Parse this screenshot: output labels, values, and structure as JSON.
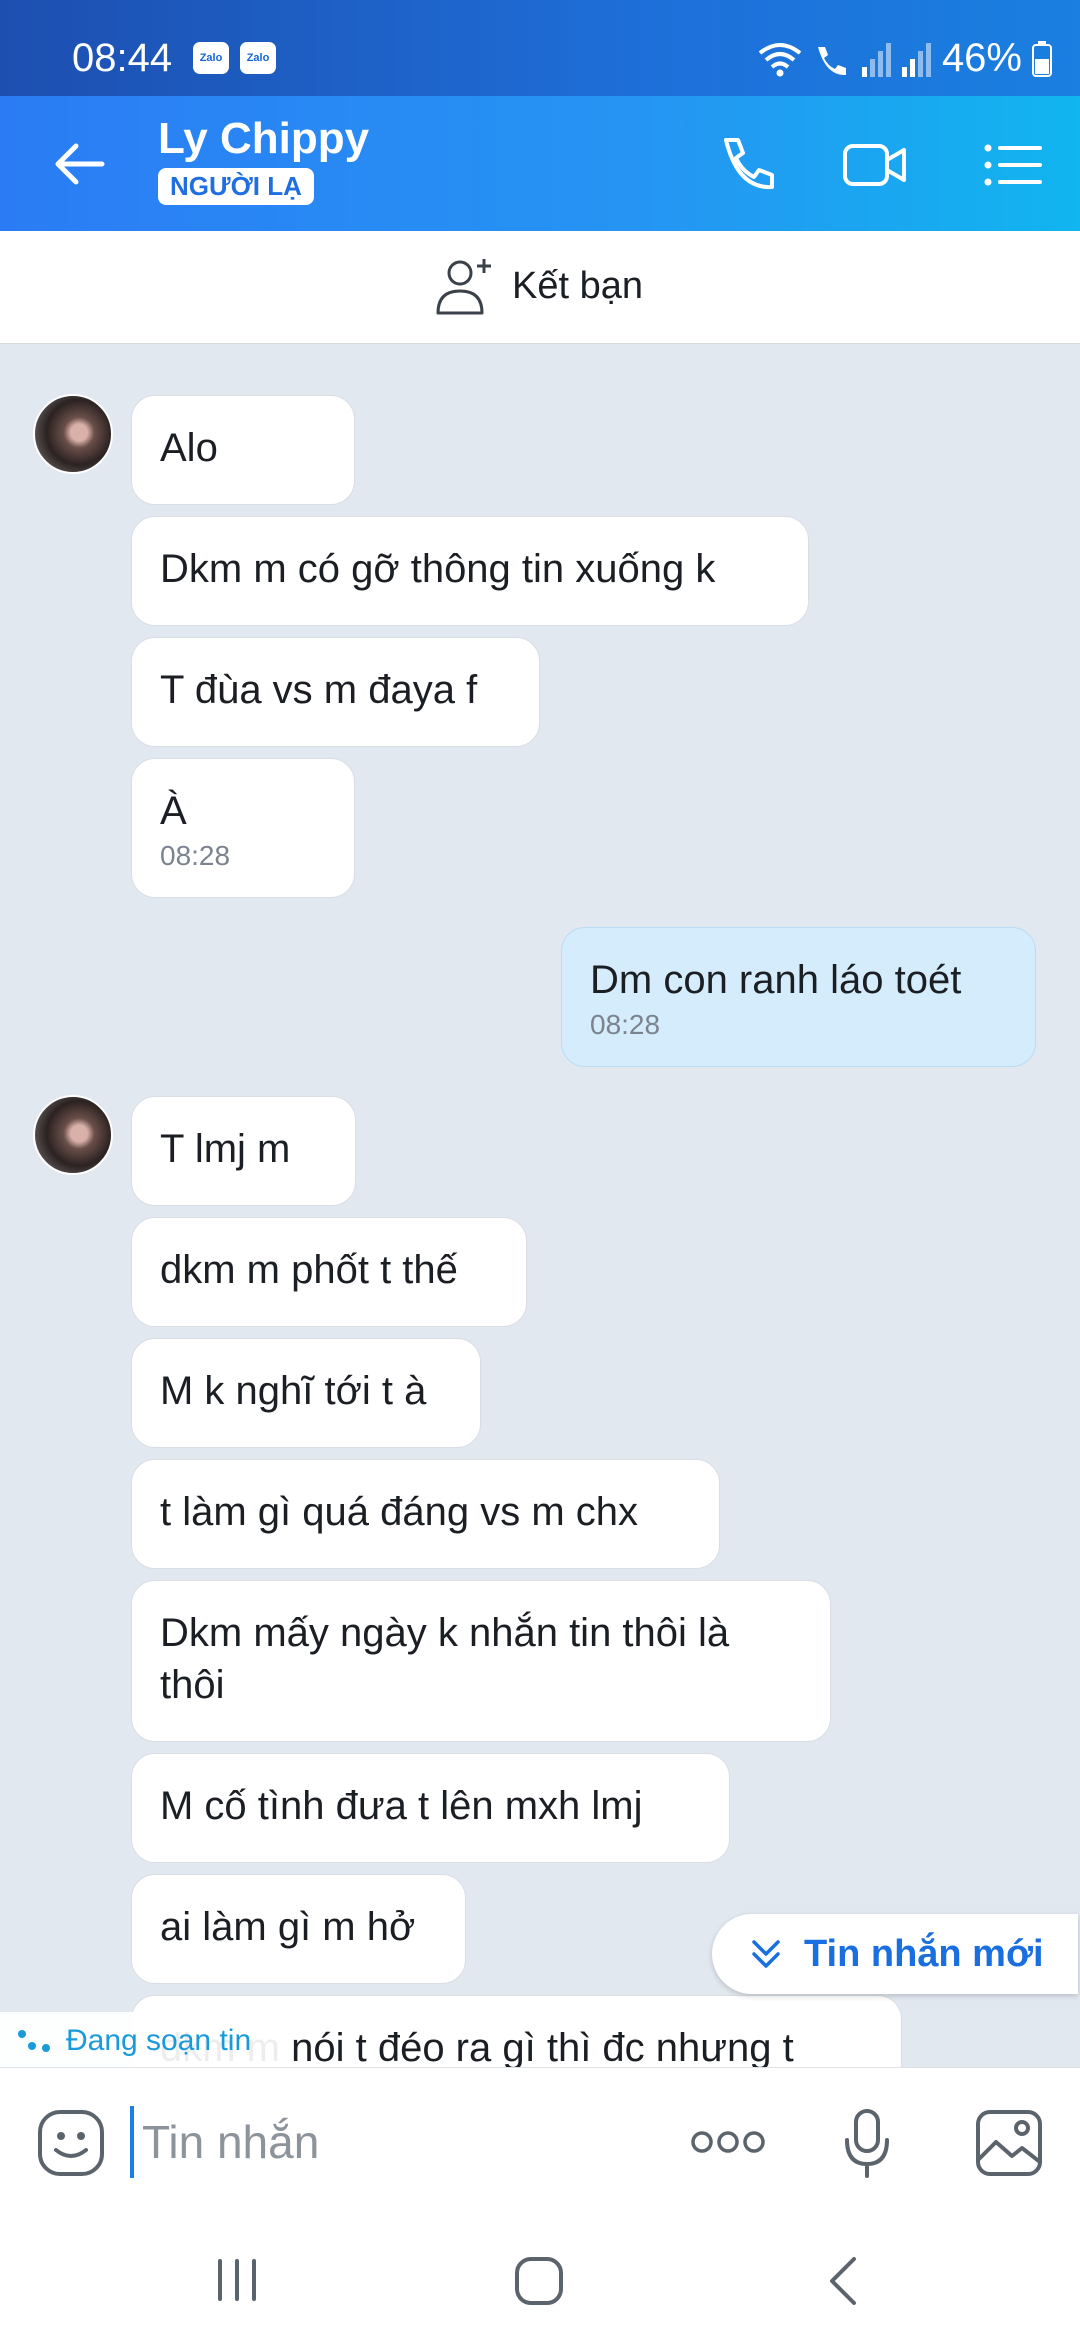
{
  "status_bar": {
    "time": "08:44",
    "badge_1": "Zalo",
    "badge_2": "Zalo",
    "battery": "46%"
  },
  "header": {
    "contact_name": "Ly Chippy",
    "badge": "NGƯỜI LẠ"
  },
  "add_friend": {
    "label": "Kết bạn"
  },
  "messages": [
    {
      "text": "Alo"
    },
    {
      "text": "Dkm m có gỡ thông tin xuống k"
    },
    {
      "text": "T đùa vs m đaya f"
    },
    {
      "text": "À",
      "time": "08:28"
    },
    {
      "text": "Dm con ranh láo toét",
      "time": "08:28"
    },
    {
      "text": "T lmj m"
    },
    {
      "text": "dkm m phốt t thế"
    },
    {
      "text": "M k nghĩ tới t à"
    },
    {
      "text": "t làm gì quá đáng vs m chx"
    },
    {
      "text": "Dkm mấy ngày k nhắn tin thôi là thôi"
    },
    {
      "text": "M cố tình đưa t lên mxh lmj"
    },
    {
      "text": "ai làm gì m hở"
    },
    {
      "text": "dkm m nói t đéo ra gì thì đc nhưng t"
    }
  ],
  "new_messages_button": {
    "label": "Tin nhắn mới"
  },
  "typing_indicator": {
    "label": "Đang soạn tin"
  },
  "composer": {
    "placeholder": "Tin nhắn"
  },
  "colors": {
    "header_blue": "#2b7cf4",
    "my_bubble": "#d5ecfd",
    "chat_bg": "#e2e8f0",
    "accent": "#1a6fe0"
  }
}
